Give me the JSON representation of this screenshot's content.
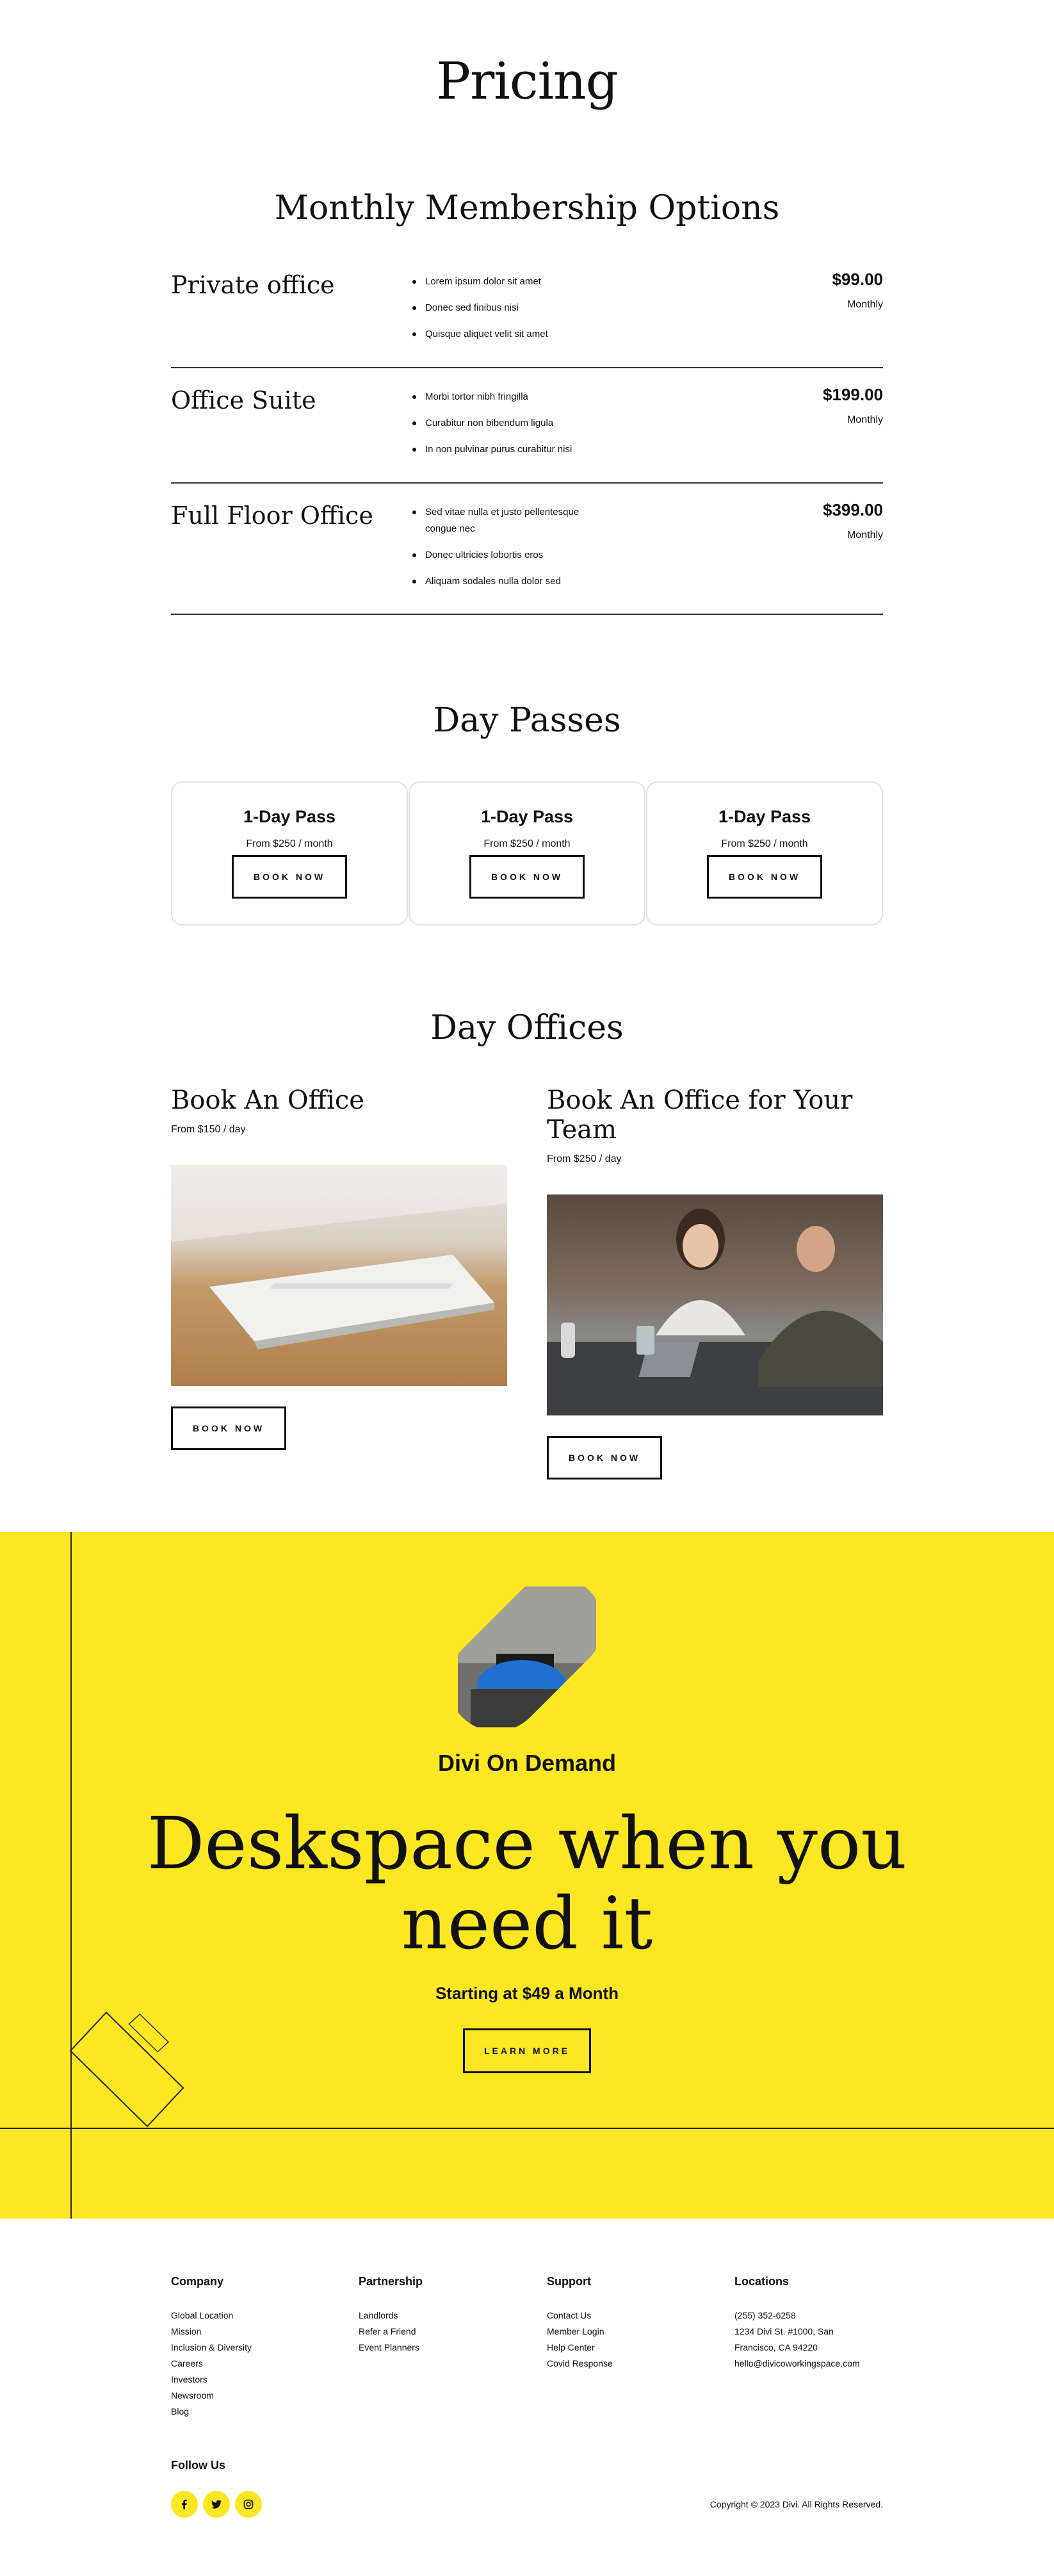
{
  "page": {
    "title": "Pricing"
  },
  "membership": {
    "title": "Monthly Membership Options",
    "plans": [
      {
        "name": "Private office",
        "features": [
          "Lorem ipsum dolor sit amet",
          "Donec sed finibus nisi",
          "Quisque aliquet velit sit amet"
        ],
        "price": "$99.00",
        "period": "Monthly"
      },
      {
        "name": "Office Suite",
        "features": [
          "Morbi tortor nibh fringilla",
          "Curabitur non bibendum ligula",
          "In non pulvinar purus curabitur nisi"
        ],
        "price": "$199.00",
        "period": "Monthly"
      },
      {
        "name": "Full Floor Office",
        "features": [
          "Sed vitae nulla et justo pellentesque congue nec",
          "Donec ultricies lobortis eros",
          "Aliquam sodales nulla dolor sed"
        ],
        "price": "$399.00",
        "period": "Monthly"
      }
    ]
  },
  "day_passes": {
    "title": "Day Passes",
    "cards": [
      {
        "name": "1-Day Pass",
        "price": "From $250 / month",
        "button": "BOOK NOW"
      },
      {
        "name": "1-Day Pass",
        "price": "From $250 / month",
        "button": "BOOK NOW"
      },
      {
        "name": "1-Day Pass",
        "price": "From $250 / month",
        "button": "BOOK NOW"
      }
    ]
  },
  "day_offices": {
    "title": "Day Offices",
    "items": [
      {
        "name": "Book An Office",
        "price": "From $150 / day",
        "button": "BOOK NOW",
        "image": "keyboard-photo"
      },
      {
        "name": "Book An Office for Your Team",
        "price": "From $250 / day",
        "button": "BOOK NOW",
        "image": "team-meeting-photo"
      }
    ]
  },
  "hero": {
    "subtitle": "Divi On Demand",
    "title_line1": "Deskspace when you",
    "title_line2": "need it",
    "price": "Starting at $49 a Month",
    "button": "LEARN MORE",
    "accent_color": "#fde722"
  },
  "footer": {
    "columns": [
      {
        "heading": "Company",
        "links": [
          "Global Location",
          "Mission",
          "Inclusion & Diversity",
          "Careers",
          "Investors",
          "Newsroom",
          "Blog"
        ]
      },
      {
        "heading": "Partnership",
        "links": [
          "Landlords",
          "Refer a Friend",
          "Event Planners"
        ]
      },
      {
        "heading": "Support",
        "links": [
          "Contact Us",
          "Member Login",
          "Help Center",
          "Covid Response"
        ]
      },
      {
        "heading": "Locations",
        "links": [
          "(255) 352-6258",
          "1234 Divi St. #1000, San",
          "Francisco, CA 94220",
          "hello@divicoworkingspace.com"
        ]
      }
    ],
    "follow_label": "Follow Us",
    "socials": [
      "facebook-icon",
      "twitter-icon",
      "instagram-icon"
    ],
    "copyright": "Copyright © 2023 Divi. All Rights Reserved."
  }
}
